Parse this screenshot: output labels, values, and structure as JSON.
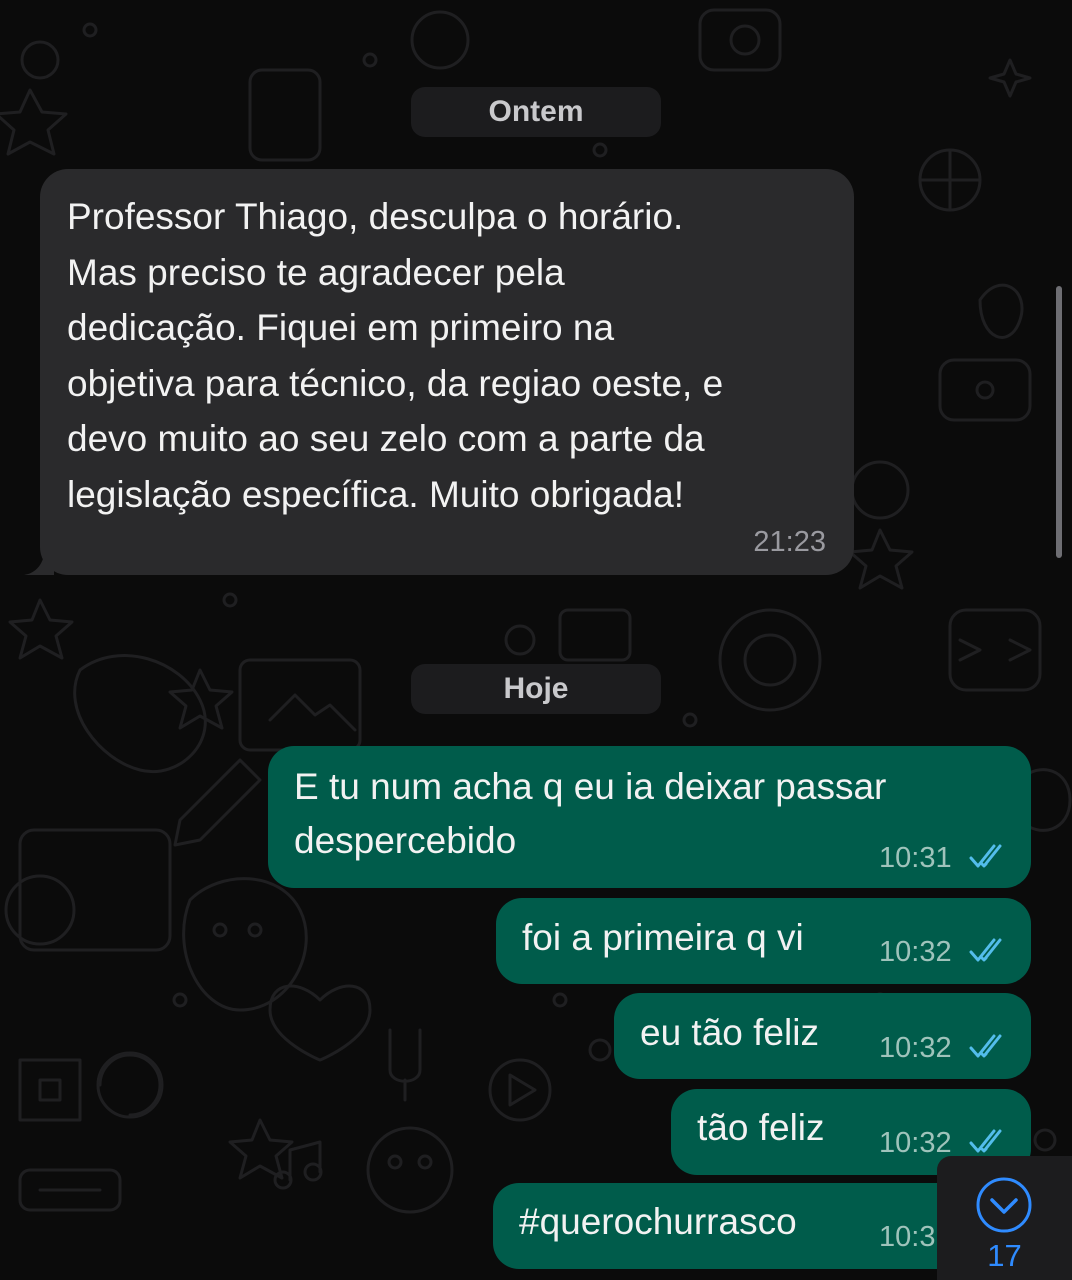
{
  "day_separators": {
    "yesterday": "Ontem",
    "today": "Hoje"
  },
  "incoming": {
    "lines": [
      "Professor Thiago, desculpa o horário.",
      "Mas preciso te agradecer pela",
      "dedicação. Fiquei em primeiro na",
      "objetiva para técnico, da regiao oeste, e",
      "devo muito ao seu zelo com a parte da",
      "legislação específica. Muito obrigada!"
    ],
    "time": "21:23"
  },
  "outgoing": [
    {
      "lines": [
        "E tu num acha q eu ia deixar passar",
        "despercebido"
      ],
      "time": "10:31",
      "status": "read"
    },
    {
      "lines": [
        "foi a primeira q vi"
      ],
      "time": "10:32",
      "status": "read"
    },
    {
      "lines": [
        "eu tão feliz"
      ],
      "time": "10:32",
      "status": "read"
    },
    {
      "lines": [
        "tão feliz"
      ],
      "time": "10:32",
      "status": "read"
    },
    {
      "lines": [
        "#querochurrasco"
      ],
      "time": "10:3",
      "status": "read"
    }
  ],
  "scroll_to_bottom": {
    "icon": "chevron-down-icon",
    "unread_count": "17"
  },
  "colors": {
    "background": "#0b0b0b",
    "incoming_bubble": "#2a2a2c",
    "outgoing_bubble": "#005c4b",
    "read_ticks": "#53bdeb",
    "unread_badge_text": "#2f8bff"
  }
}
